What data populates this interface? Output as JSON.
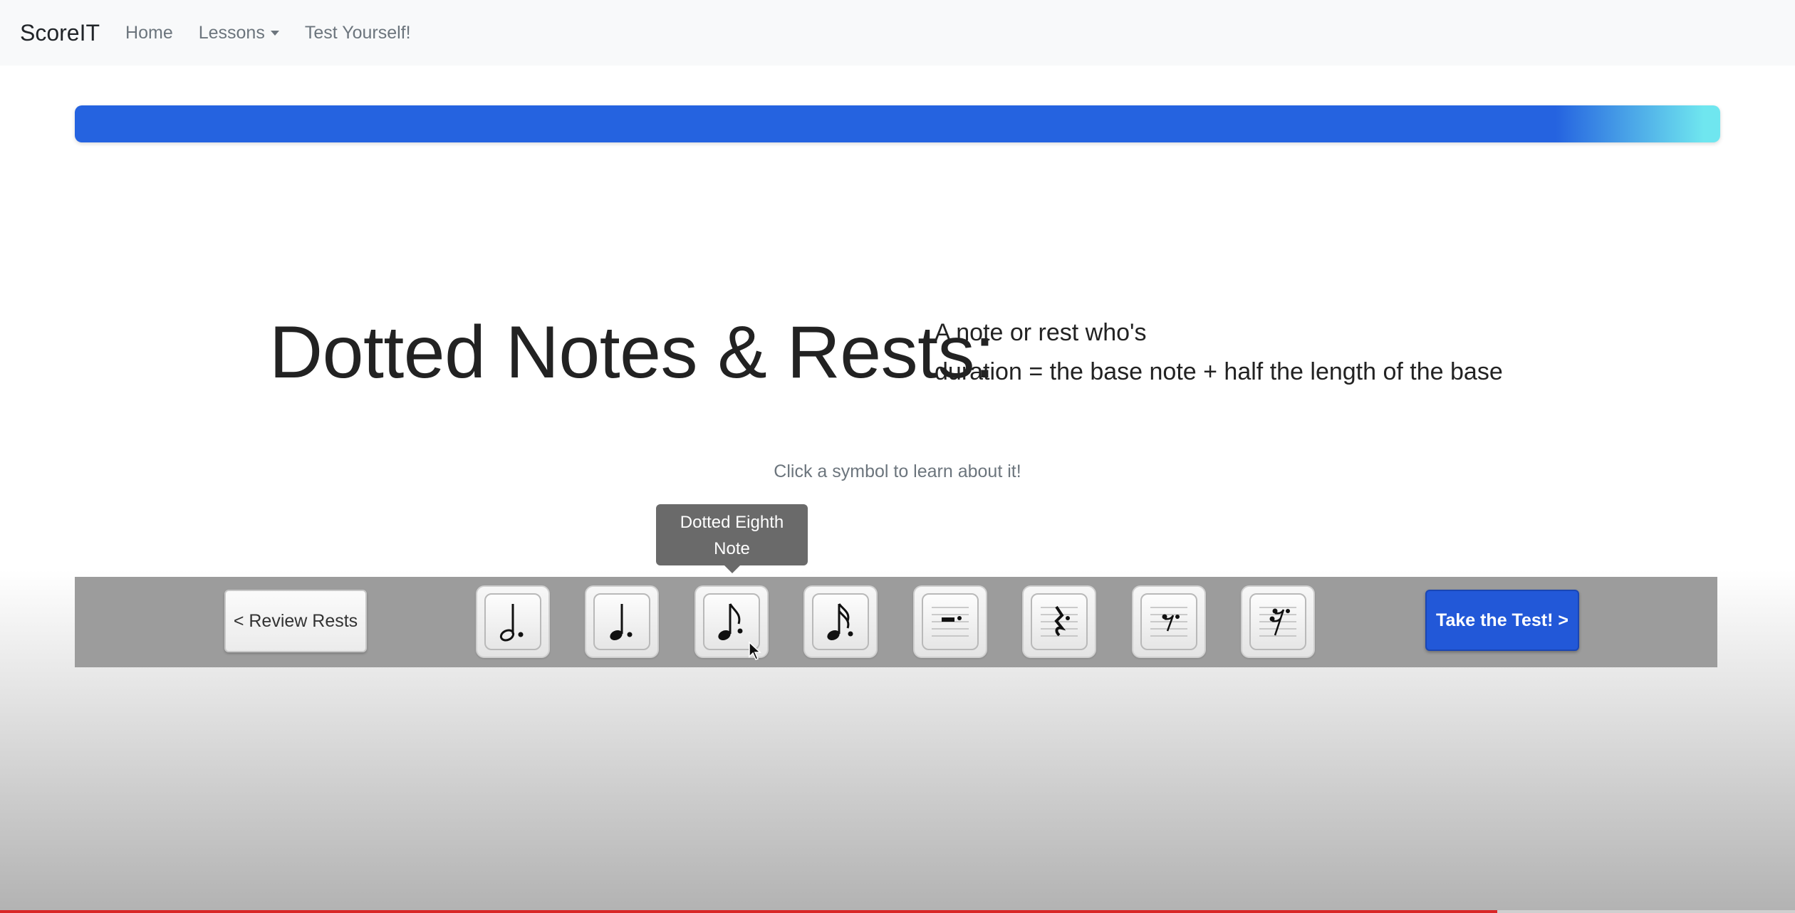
{
  "navbar": {
    "brand": "ScoreIT",
    "links": [
      {
        "label": "Home"
      },
      {
        "label": "Lessons",
        "dropdown": true
      },
      {
        "label": "Test Yourself!"
      }
    ]
  },
  "progress": {
    "value": 1.0,
    "colors": {
      "start": "#2563e0",
      "end": "#6fe6ef"
    }
  },
  "lesson": {
    "title": "Dotted Notes & Rests:",
    "definition_line1": "A note or rest who's",
    "definition_line2": "duration = the base note + half the length of the base",
    "hint": "Click a symbol to learn about it!"
  },
  "tooltip": {
    "line1": "Dotted Eighth",
    "line2": "Note"
  },
  "toolbar": {
    "prev_label": "< Review Rests",
    "next_label": "Take the Test! >",
    "symbols": [
      {
        "icon": "dotted-half-note-icon"
      },
      {
        "icon": "dotted-quarter-note-icon"
      },
      {
        "icon": "dotted-eighth-note-icon"
      },
      {
        "icon": "dotted-sixteenth-note-icon"
      },
      {
        "icon": "dotted-half-rest-icon"
      },
      {
        "icon": "dotted-quarter-rest-icon"
      },
      {
        "icon": "dotted-eighth-rest-icon"
      },
      {
        "icon": "dotted-sixteenth-rest-icon"
      }
    ]
  },
  "colors": {
    "accent": "#2258d8",
    "toolbar": "#9c9c9c",
    "tooltip": "#6a6a6a"
  }
}
